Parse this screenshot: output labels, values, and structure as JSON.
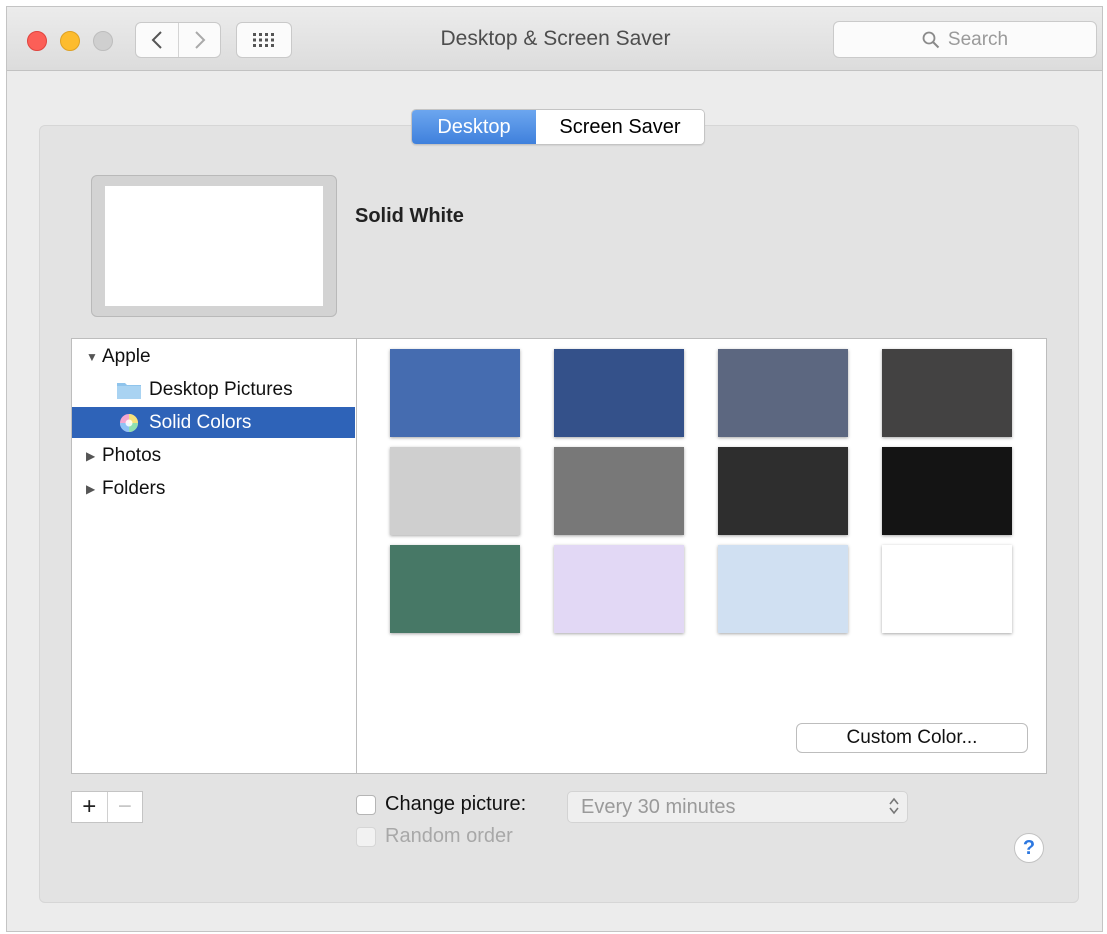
{
  "window": {
    "title": "Desktop & Screen Saver"
  },
  "toolbar": {
    "search_placeholder": "Search"
  },
  "tabs": [
    {
      "label": "Desktop",
      "active": true
    },
    {
      "label": "Screen Saver",
      "active": false
    }
  ],
  "preview": {
    "selected_name": "Solid White"
  },
  "sidebar": {
    "items": [
      {
        "label": "Apple",
        "expanded": true
      },
      {
        "label": "Desktop Pictures",
        "icon": "folder-icon"
      },
      {
        "label": "Solid Colors",
        "icon": "color-wheel-icon",
        "selected": true
      },
      {
        "label": "Photos",
        "expanded": false
      },
      {
        "label": "Folders",
        "expanded": false
      }
    ]
  },
  "swatches": [
    "#456cb0",
    "#34518a",
    "#5c6780",
    "#434242",
    "#cfcfcf",
    "#787878",
    "#2e2e2e",
    "#141414",
    "#477866",
    "#e2d8f5",
    "#d0e0f2",
    "#ffffff"
  ],
  "buttons": {
    "custom_color": "Custom Color...",
    "add": "+",
    "remove": "−"
  },
  "options": {
    "change_picture_label": "Change picture:",
    "change_picture_interval": "Every 30 minutes",
    "random_order_label": "Random order"
  },
  "help": "?"
}
